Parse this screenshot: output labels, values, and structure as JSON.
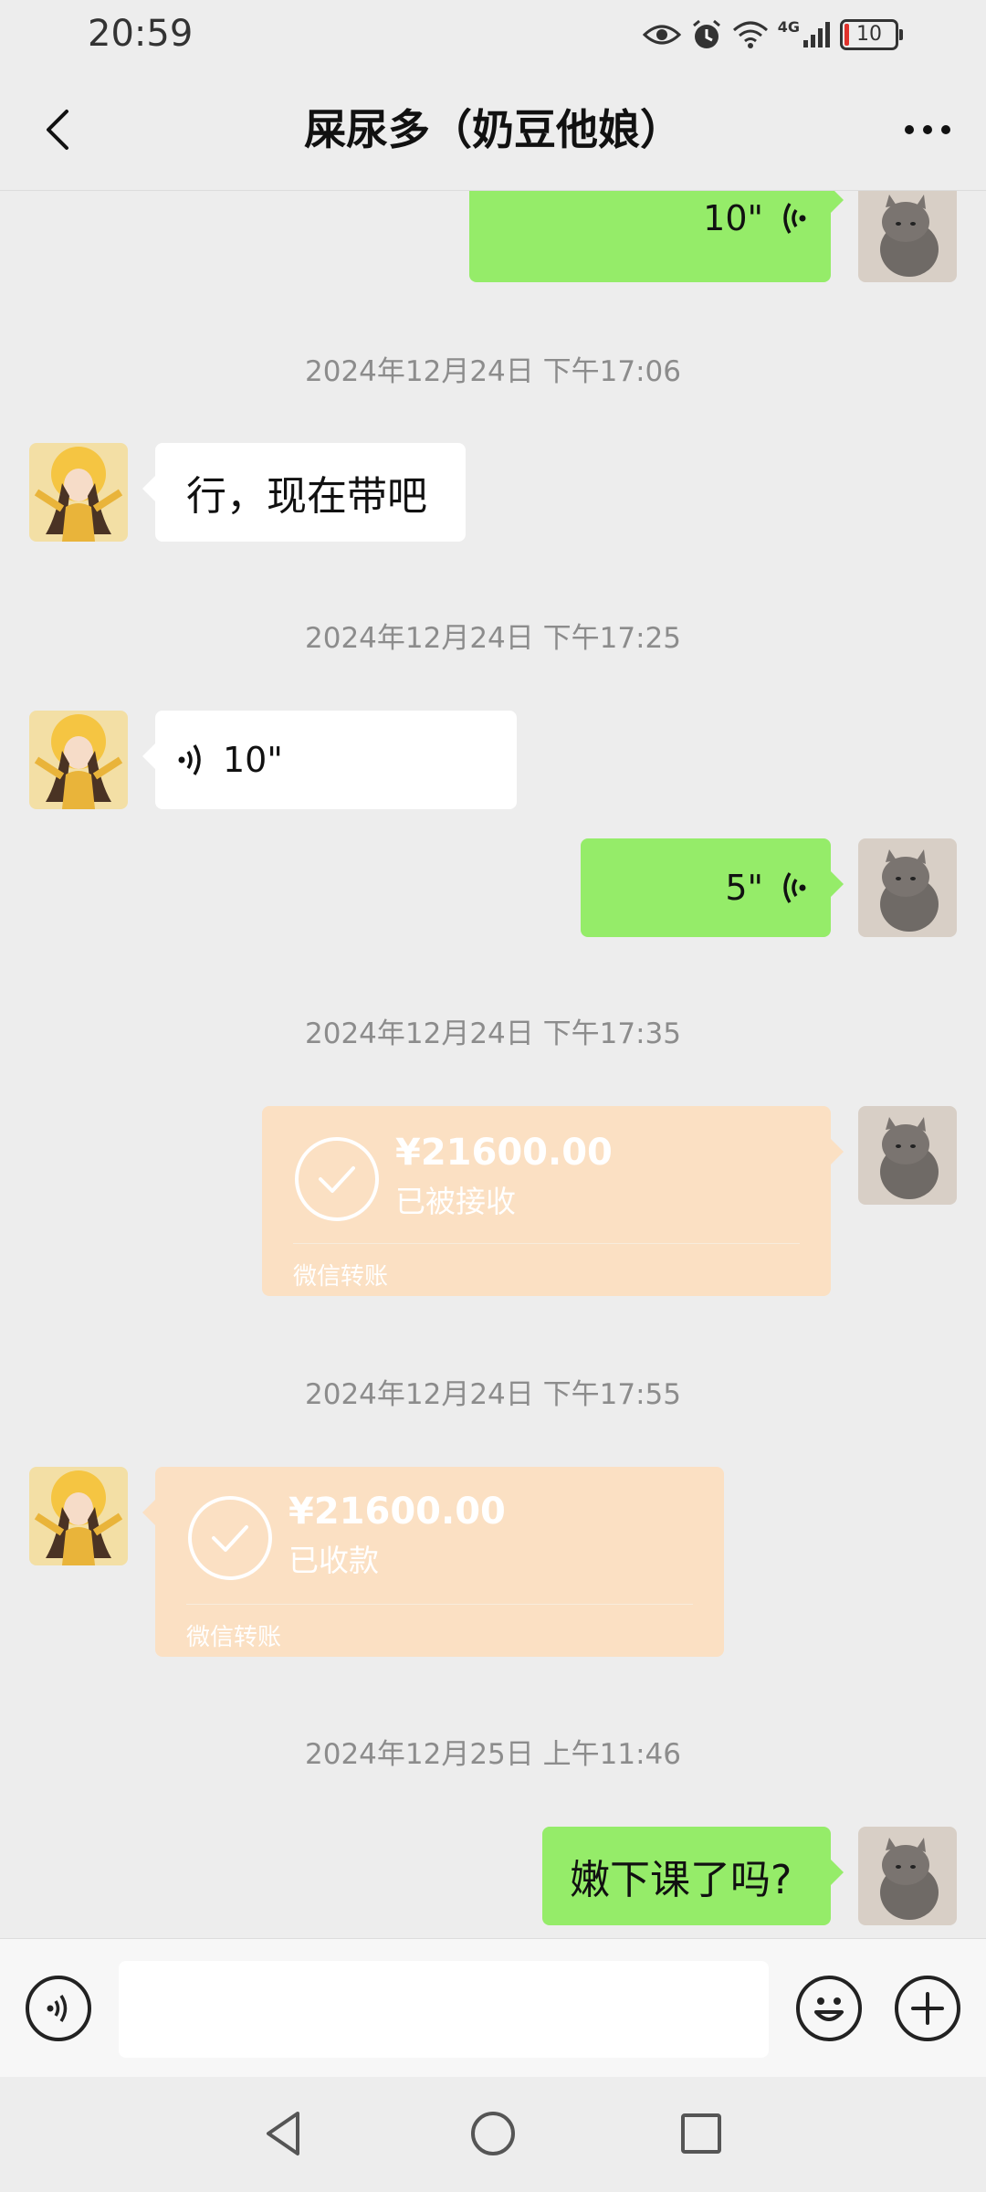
{
  "status_bar": {
    "time": "20:59",
    "network_label": "4G",
    "battery_level": "10",
    "icons": [
      "eye-icon",
      "alarm-icon",
      "wifi-icon",
      "signal-icon",
      "battery-icon"
    ]
  },
  "header": {
    "title": "屎尿多（奶豆他娘）",
    "back_icon": "chevron-left-icon",
    "more_icon": "more-dots-icon"
  },
  "messages": [
    {
      "type": "voice",
      "side": "right",
      "duration": "10\""
    },
    {
      "type": "timestamp",
      "text": "2024年12月24日 下午17:06"
    },
    {
      "type": "text",
      "side": "left",
      "text": "行，现在带吧"
    },
    {
      "type": "timestamp",
      "text": "2024年12月24日 下午17:25"
    },
    {
      "type": "voice",
      "side": "left",
      "duration": "10\""
    },
    {
      "type": "voice",
      "side": "right",
      "duration": "5\""
    },
    {
      "type": "timestamp",
      "text": "2024年12月24日 下午17:35"
    },
    {
      "type": "transfer",
      "side": "right",
      "amount": "¥21600.00",
      "status": "已被接收",
      "footer": "微信转账"
    },
    {
      "type": "timestamp",
      "text": "2024年12月24日 下午17:55"
    },
    {
      "type": "transfer",
      "side": "left",
      "amount": "¥21600.00",
      "status": "已收款",
      "footer": "微信转账"
    },
    {
      "type": "timestamp",
      "text": "2024年12月25日 上午11:46"
    },
    {
      "type": "text",
      "side": "right",
      "text": "嫩下课了吗?"
    }
  ],
  "input_bar": {
    "placeholder": "",
    "voice_icon": "voice-input-icon",
    "emoji_icon": "emoji-icon",
    "plus_icon": "plus-icon"
  },
  "colors": {
    "self_bubble": "#95ec69",
    "other_bubble": "#ffffff",
    "transfer_card": "#fbe0c3",
    "background": "#ededed"
  }
}
